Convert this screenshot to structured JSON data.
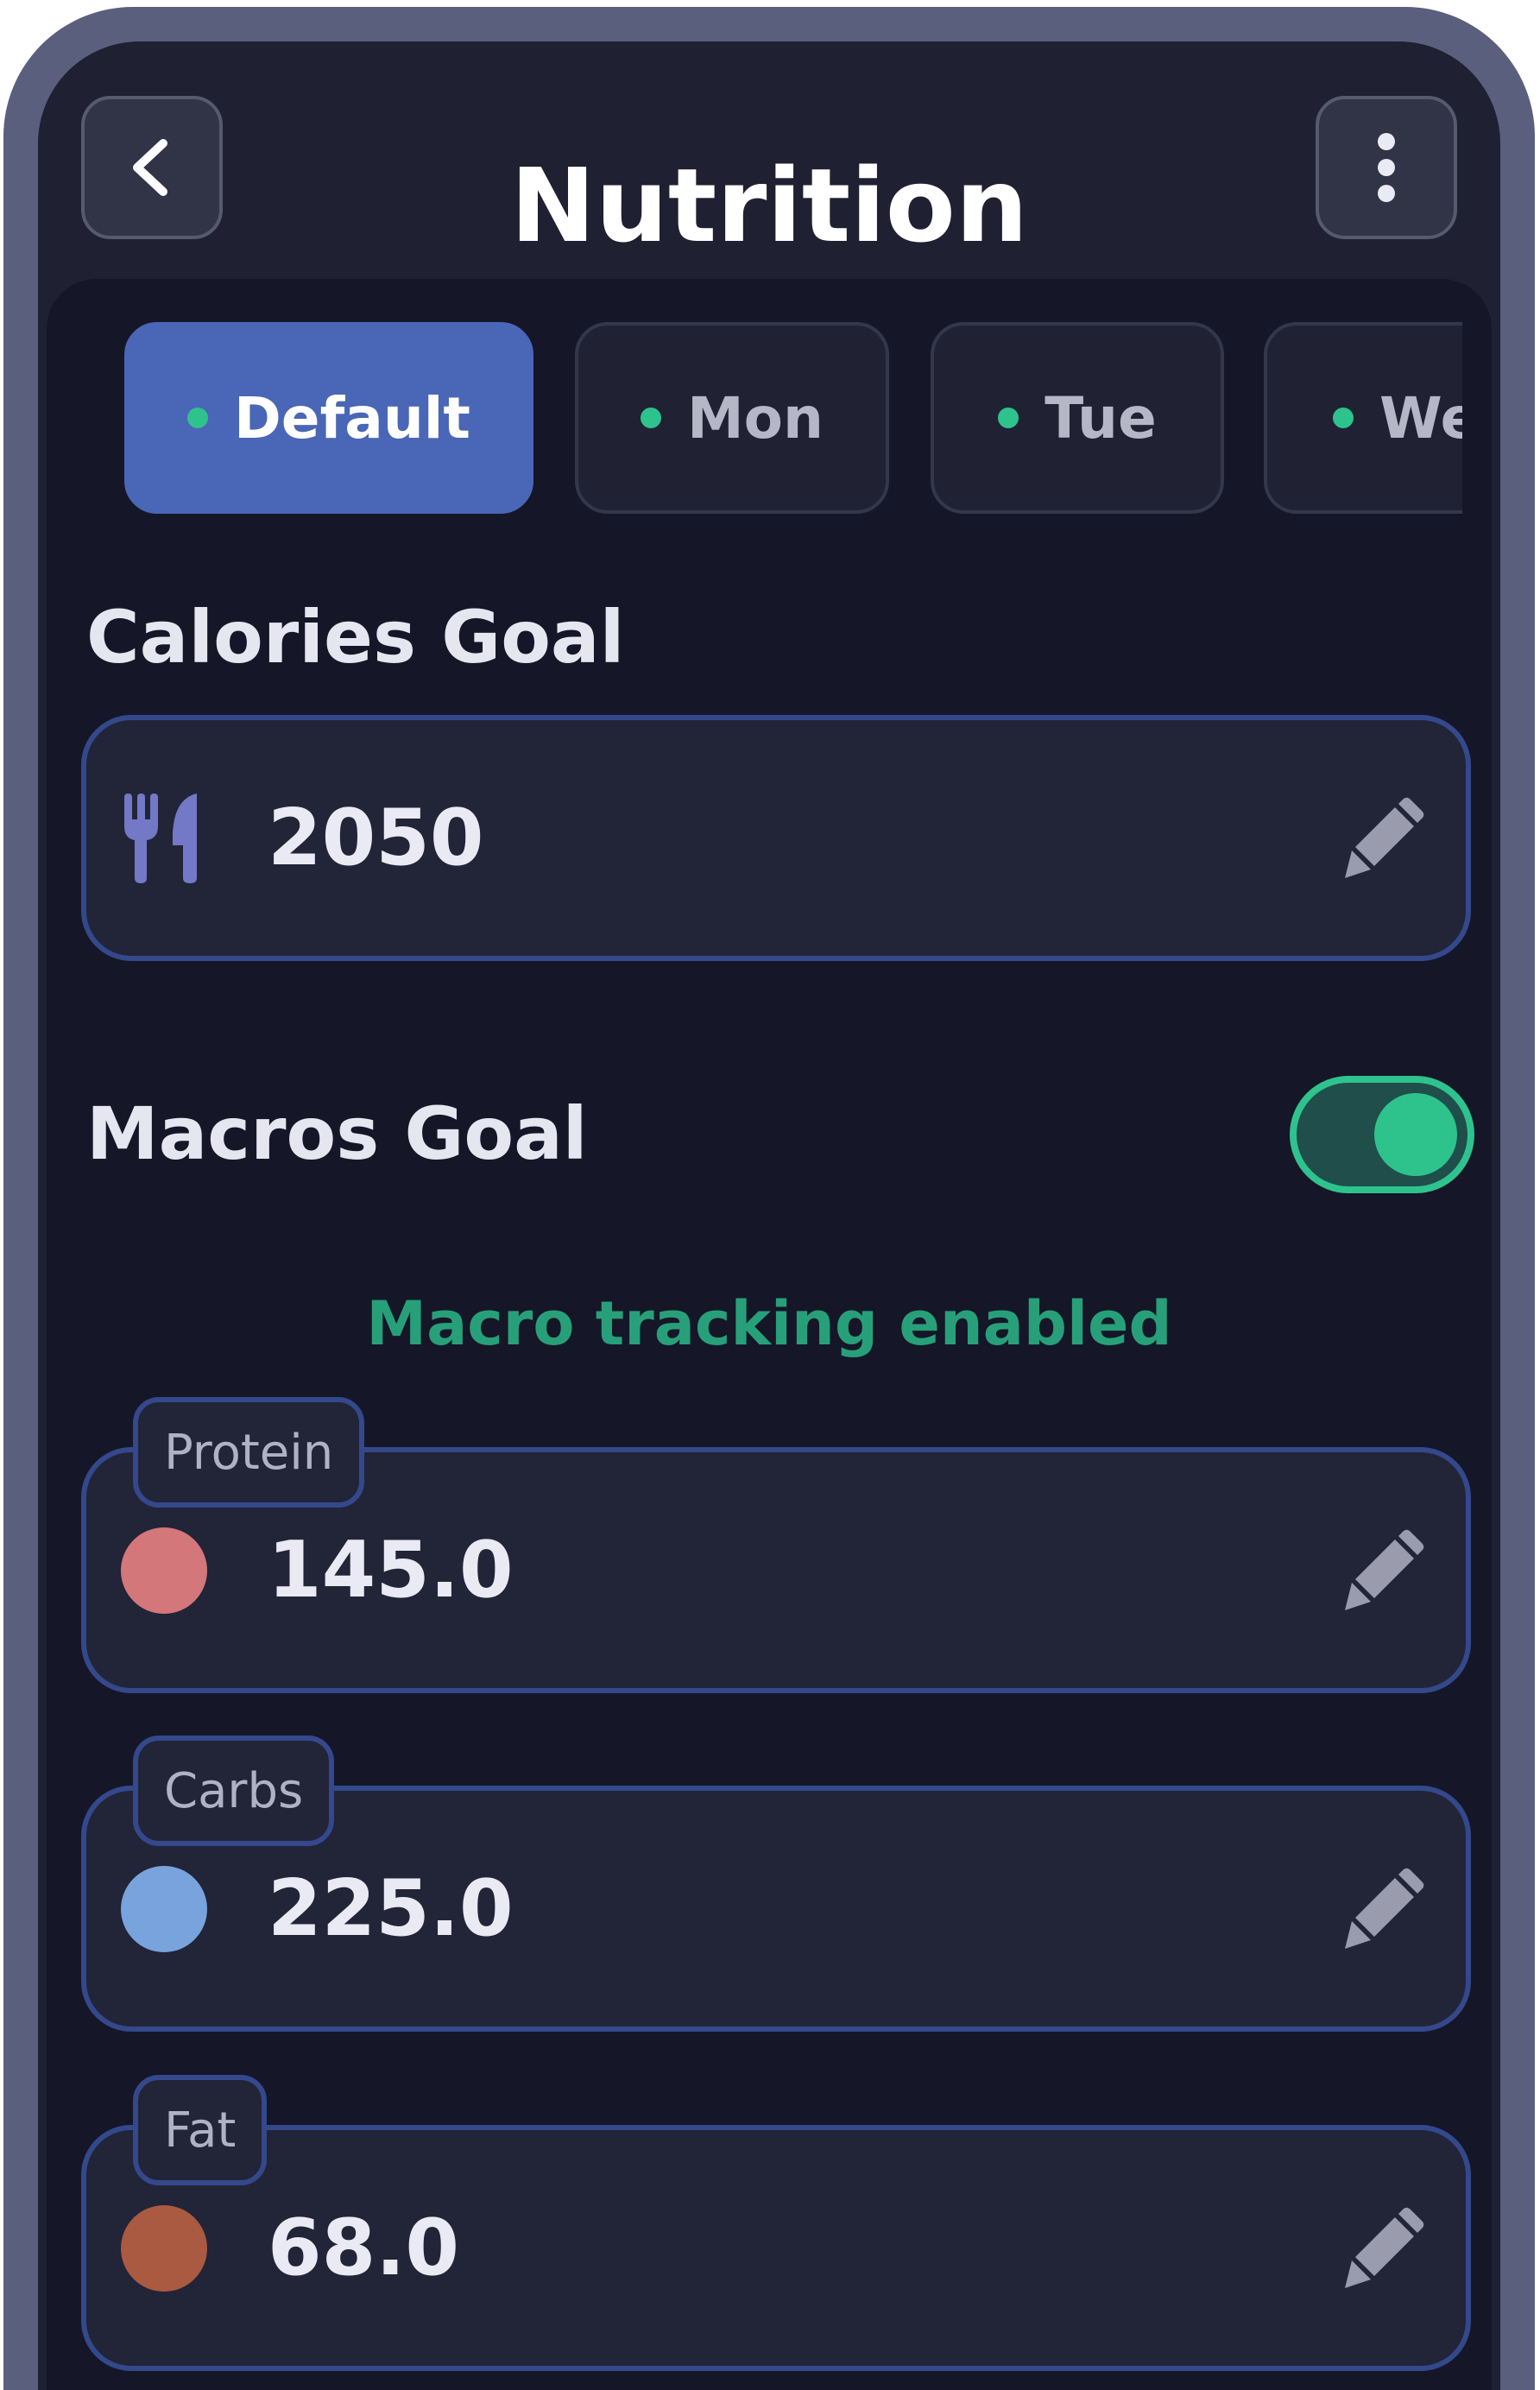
{
  "header": {
    "title": "Nutrition",
    "back_icon": "chevron-left-icon",
    "more_icon": "vertical-dots-icon"
  },
  "tabs": [
    {
      "label": "Default",
      "active": true
    },
    {
      "label": "Mon",
      "active": false
    },
    {
      "label": "Tue",
      "active": false
    },
    {
      "label": "We",
      "active": false
    }
  ],
  "calories": {
    "label": "Calories Goal",
    "value": "2050",
    "icon": "utensils-icon",
    "edit_icon": "pencil-icon"
  },
  "macros": {
    "label": "Macros Goal",
    "toggle_on": true,
    "status": "Macro tracking enabled",
    "items": [
      {
        "label": "Protein",
        "value": "145.0",
        "color": "#d4777a"
      },
      {
        "label": "Carbs",
        "value": "225.0",
        "color": "#78a3dc"
      },
      {
        "label": "Fat",
        "value": "68.0",
        "color": "#a95a41"
      }
    ]
  },
  "colors": {
    "accent": "#4a66b6",
    "success": "#2ec38d",
    "field_border": "#34488c",
    "background": "#151627"
  }
}
